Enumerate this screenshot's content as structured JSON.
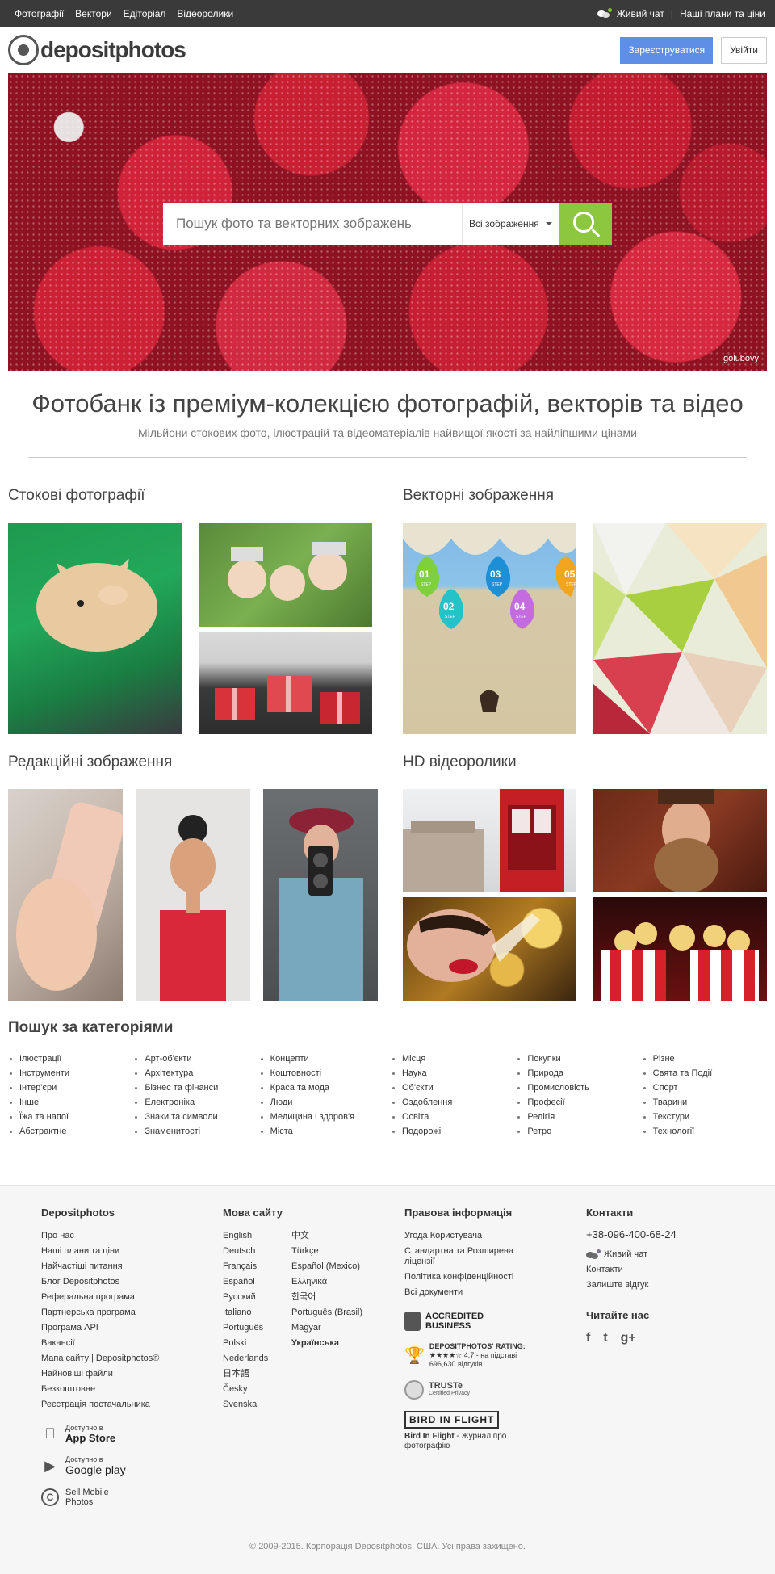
{
  "topbar": {
    "nav": [
      "Фотографії",
      "Вектори",
      "Едіторіал",
      "Відеоролики"
    ],
    "live_chat": "Живий чат",
    "plans": "Наші плани та ціни"
  },
  "header": {
    "logo_text": "depositphotos",
    "register": "Зареєструватися",
    "login": "Увійти"
  },
  "hero": {
    "search_placeholder": "Пошук фото та векторних зображень",
    "select_value": "Всі зображення",
    "credit": "golubovy"
  },
  "headline": {
    "title": "Фотобанк із преміум-колекцією фотографій, векторів та відео",
    "subtitle": "Мільйони стокових фото, ілюстрацій та відеоматеріалів найвищої якості за найліпшими цінами"
  },
  "sections": {
    "stock": "Стокові фотографії",
    "vector": "Векторні зображення",
    "editorial": "Редакційні зображення",
    "video": "HD відеоролики"
  },
  "vector_steps": [
    "01",
    "02",
    "03",
    "04",
    "05"
  ],
  "vector_step_word": "STEP",
  "categories": {
    "title": "Пошук за категоріями",
    "columns": [
      [
        "Ілюстрації",
        "Інструменти",
        "Інтер'єри",
        "Інше",
        "Їжа та напої",
        "Абстрактне"
      ],
      [
        "Арт-об'єкти",
        "Архітектура",
        "Бізнес та фінанси",
        "Електроніка",
        "Знаки та символи",
        "Знаменитості"
      ],
      [
        "Концепти",
        "Коштовності",
        "Краса та мода",
        "Люди",
        "Медицина і здоров'я",
        "Міста"
      ],
      [
        "Місця",
        "Наука",
        "Об'єкти",
        "Оздоблення",
        "Освіта",
        "Подорожі"
      ],
      [
        "Покупки",
        "Природа",
        "Промисловість",
        "Професії",
        "Релігія",
        "Ретро"
      ],
      [
        "Різне",
        "Свята та Події",
        "Спорт",
        "Тварини",
        "Текстури",
        "Технології"
      ]
    ]
  },
  "footer": {
    "col1_title": "Depositphotos",
    "col1_links": [
      "Про нас",
      "Наші плани та ціни",
      "Найчастіші питання",
      "Блог Depositphotos",
      "Реферальна програма",
      "Партнерська програма",
      "Програма API",
      "Вакансії",
      "Мапа сайту | Depositphotos®",
      "Найновіші файли",
      "Безкоштовне",
      "Реєстрація постачальника"
    ],
    "appstore_small": "Доступно в",
    "appstore_big": "App Store",
    "gplay_small": "Доступно в",
    "gplay_big": "Google play",
    "sell_mobile": "Sell Mobile Photos",
    "col2_title": "Мова сайту",
    "langs_left": [
      "English",
      "Deutsch",
      "Français",
      "Español",
      "Русский",
      "Italiano",
      "Português",
      "Polski",
      "Nederlands",
      "日本語",
      "Česky",
      "Svenska"
    ],
    "langs_right": [
      "中文",
      "Türkçe",
      "Español (Mexico)",
      "Ελληνικά",
      "한국어",
      "Português (Brasil)",
      "Magyar",
      "Українська"
    ],
    "col3_title": "Правова інформація",
    "col3_links": [
      "Угода Користувача",
      "Стандартна та Розширена ліцензії",
      "Політика конфіденційності",
      "Всі документи"
    ],
    "bbb_1": "ACCREDITED",
    "bbb_2": "BUSINESS",
    "rating_title": "DEPOSITPHOTOS' RATING:",
    "rating_value": "4.7 - на підставі",
    "rating_count": "696,630 відгуків",
    "truste": "TRUSTe",
    "truste_sub": "Certified Privacy",
    "bif_logo": "BIRD IN FLIGHT",
    "bif_name": "Bird In Flight",
    "bif_text": " - Журнал про фотографію",
    "col4_title": "Контакти",
    "phone": "+38-096-400-68-24",
    "live_chat": "Живий чат",
    "contacts": "Контакти",
    "feedback": "Залиште відгук",
    "read_us": "Читайте нас",
    "social": [
      "f",
      "t",
      "g+"
    ],
    "copyright": "© 2009-2015. Корпорація Depositphotos, США. Усі права захищено."
  }
}
